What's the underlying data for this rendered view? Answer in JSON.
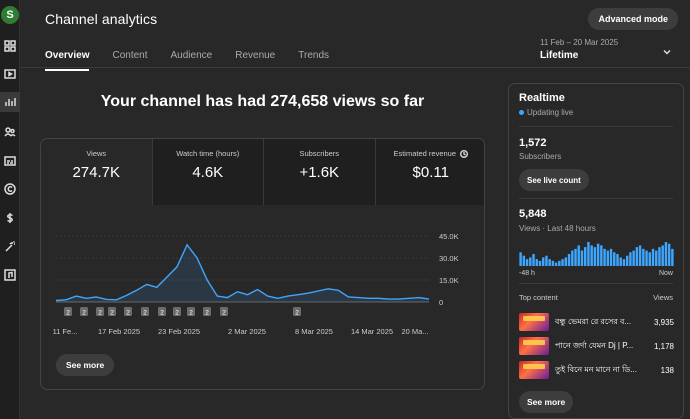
{
  "rail": {
    "avatar_letter": "S",
    "icons": [
      "dashboard-icon",
      "content-icon",
      "analytics-icon",
      "community-icon",
      "subtitles-icon",
      "copyright-icon",
      "earn-icon",
      "customization-icon",
      "audio-library-icon"
    ]
  },
  "header": {
    "title": "Channel analytics",
    "advanced_mode": "Advanced mode"
  },
  "tabs": [
    "Overview",
    "Content",
    "Audience",
    "Revenue",
    "Trends"
  ],
  "date_range": {
    "range": "11 Feb – 20 Mar 2025",
    "period": "Lifetime"
  },
  "headline": "Your channel has had 274,658 views so far",
  "metrics": [
    {
      "label": "Views",
      "value": "274.7K"
    },
    {
      "label": "Watch time (hours)",
      "value": "4.6K"
    },
    {
      "label": "Subscribers",
      "value": "+1.6K"
    },
    {
      "label": "Estimated revenue",
      "value": "$0.11"
    }
  ],
  "chart_data": {
    "type": "line",
    "x_ticks": [
      "11 Fe...",
      "17 Feb 2025",
      "23 Feb 2025",
      "2 Mar 2025",
      "8 Mar 2025",
      "14 Mar 2025",
      "20 Ma..."
    ],
    "y_ticks": [
      "45.0K",
      "30.0K",
      "15.0K",
      "0"
    ],
    "ylim": [
      0,
      45000
    ],
    "values": [
      1000,
      1500,
      4000,
      2500,
      3500,
      1800,
      1500,
      4500,
      8000,
      12000,
      10000,
      17000,
      24000,
      39000,
      30000,
      15000,
      4000,
      3000,
      7000,
      5000,
      8500,
      4000,
      2500,
      4000,
      5000,
      6000,
      7500,
      9000,
      8000,
      3500,
      3000,
      2500,
      2500,
      2000,
      2000,
      2500,
      3000,
      2000
    ],
    "markers": [
      "2",
      "2",
      "2",
      "2",
      "2",
      "2",
      "2",
      "2",
      "2",
      "2",
      "2",
      "2"
    ],
    "color": "#3ea6ff",
    "grid": true
  },
  "see_more": "See more",
  "realtime": {
    "title": "Realtime",
    "status": "Updating live",
    "subscribers_value": "1,572",
    "subscribers_label": "Subscribers",
    "see_live_count": "See live count",
    "views_value": "5,848",
    "views_label": "Views · Last 48 hours",
    "bar_values": [
      8,
      6,
      4,
      5,
      7,
      4,
      3,
      5,
      6,
      4,
      3,
      2,
      3,
      4,
      5,
      7,
      9,
      10,
      12,
      9,
      11,
      14,
      12,
      11,
      13,
      12,
      10,
      9,
      10,
      8,
      7,
      5,
      4,
      6,
      8,
      9,
      11,
      12,
      10,
      9,
      8,
      10,
      9,
      11,
      12,
      14,
      13,
      10
    ],
    "bar_start": "-48 h",
    "bar_end": "Now",
    "top_content_label": "Top content",
    "top_content_views_label": "Views",
    "top_content": [
      {
        "title": "বন্ধু ভেমরা রে রসের ব...",
        "views": "3,935"
      },
      {
        "title": "পানে জর্দা যেমন Dj | P...",
        "views": "1,178"
      },
      {
        "title": "তুই বিনে মন মানে না ডি...",
        "views": "138"
      }
    ],
    "see_more": "See more"
  },
  "colors": {
    "background": "#282828",
    "accent": "#3ea6ff",
    "avatar": "#2e7d32"
  }
}
